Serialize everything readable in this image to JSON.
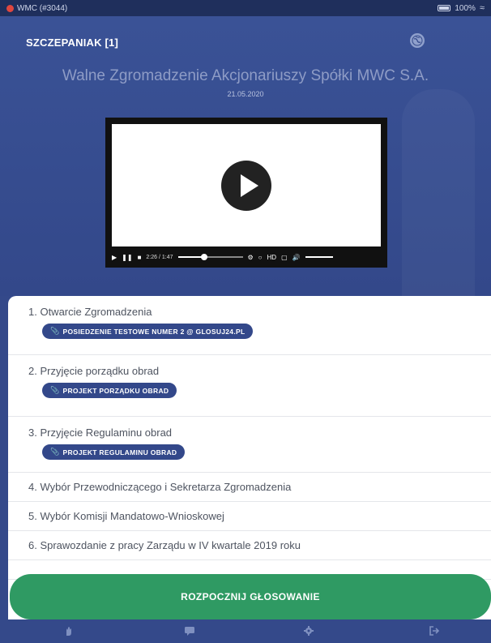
{
  "status_bar": {
    "app_label": "WMC (#3044)",
    "battery_text": "100%"
  },
  "header": {
    "user_name": "SZCZEPANIAK [1]",
    "globe_icon": "globe-icon"
  },
  "meeting": {
    "title": "Walne Zgromadzenie Akcjonariuszy Spółki MWC S.A.",
    "date": "21.05.2020"
  },
  "video": {
    "time_text": "2:26 / 1:47",
    "progress": 0.4,
    "hd_label": "HD"
  },
  "agenda": {
    "items": [
      {
        "label": "1. Otwarcie Zgromadzenia",
        "document": "POSIEDZENIE TESTOWE NUMER 2 @ GLOSUJ24.PL"
      },
      {
        "label": "2. Przyjęcie porządku obrad",
        "document": "PROJEKT PORZĄDKU OBRAD"
      },
      {
        "label": "3. Przyjęcie Regulaminu obrad",
        "document": "PROJEKT REGULAMINU OBRAD"
      },
      {
        "label": "4. Wybór Przewodniczącego i Sekretarza Zgromadzenia"
      },
      {
        "label": "5. Wybór Komisji Mandatowo-Wnioskowej"
      },
      {
        "label": "6. Sprawozdanie z pracy Zarządu w IV kwartale 2019 roku"
      }
    ]
  },
  "actions": {
    "start_voting_label": "ROZPOCZNIJ GŁOSOWANIE"
  },
  "nav": {
    "icons": [
      "hand-icon",
      "chat-icon",
      "settings-icon",
      "logout-icon"
    ]
  },
  "colors": {
    "primary": "#34498a",
    "accent_green": "#2f9a63",
    "badge": "#33488a"
  }
}
